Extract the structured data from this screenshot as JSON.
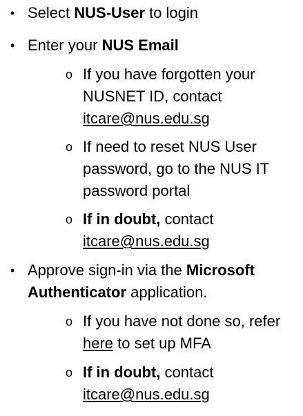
{
  "bullets": {
    "main": "•",
    "sub": "o"
  },
  "items": [
    {
      "pre": "Select ",
      "bold": "NUS-User",
      "post": " to login"
    },
    {
      "pre": "Enter your ",
      "bold": "NUS Email",
      "post": "",
      "subitems": [
        {
          "line1": "If you have forgotten your",
          "line2": "NUSNET ID, contact",
          "link": "itcare@nus.edu.sg"
        },
        {
          "line1": "If need to reset NUS User",
          "line2": "password, go to the NUS IT",
          "line3": "password portal"
        },
        {
          "bold": "If in doubt,",
          "text": " contact",
          "link": "itcare@nus.edu.sg"
        }
      ]
    },
    {
      "pre": "Approve sign-in via the ",
      "bold1": "Microsoft",
      "bold2": "Authenticator",
      "post": " application.",
      "subitems": [
        {
          "line1": "If you have not done so, refer",
          "link": "here",
          "post": " to set up MFA"
        },
        {
          "bold": "If in doubt,",
          "text": " contact",
          "link": "itcare@nus.edu.sg"
        }
      ]
    }
  ]
}
